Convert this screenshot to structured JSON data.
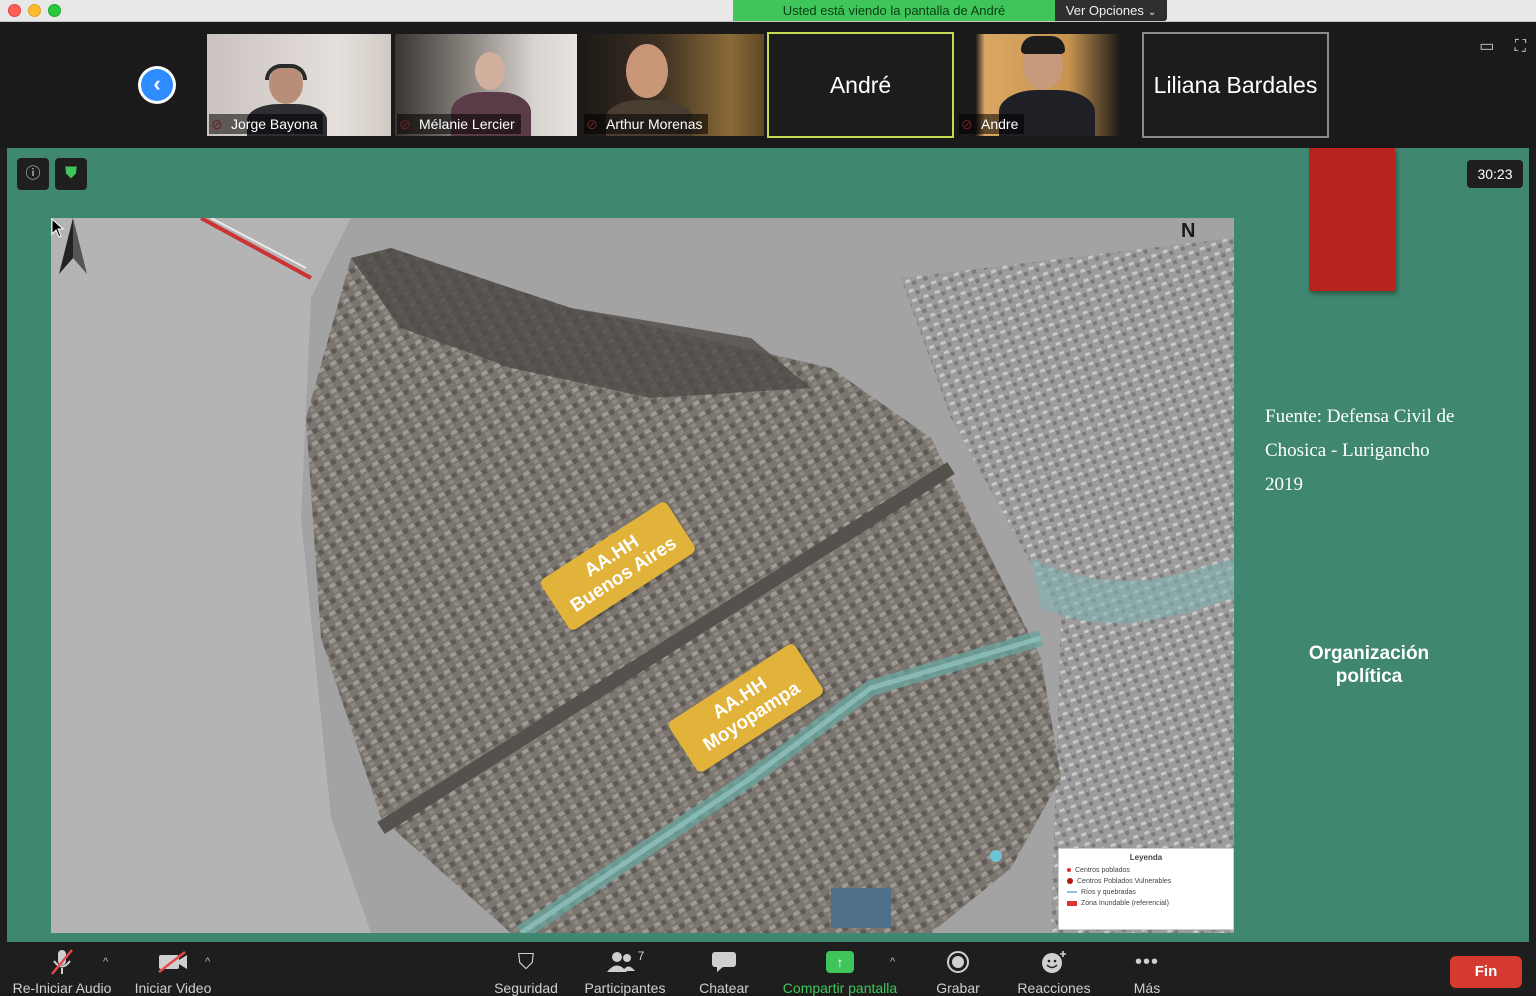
{
  "banner": {
    "sharing_text": "Usted está viendo la pantalla de André",
    "options_label": "Ver Opciones"
  },
  "participants": [
    {
      "name": "Jorge Bayona",
      "video": true,
      "muted": true
    },
    {
      "name": "Mélanie Lercier",
      "video": true,
      "muted": true
    },
    {
      "name": "Arthur Morenas",
      "video": true,
      "muted": true
    },
    {
      "name": "André",
      "video": false,
      "active_speaker": true
    },
    {
      "name": "Andre",
      "video": true,
      "muted": true
    },
    {
      "name": "Liliana Bardales",
      "video": false
    }
  ],
  "screen": {
    "timer": "30:23",
    "source_line1": "Fuente: Defensa Civil de",
    "source_line2": "Chosica - Lurigancho",
    "source_line3": "2019",
    "org_title": "Organización política",
    "map": {
      "north_label": "N",
      "tag1_line1": "AA.HH",
      "tag1_line2": "Buenos Aires",
      "tag2_line1": "AA.HH",
      "tag2_line2": "Moyopampa",
      "legend_title": "Leyenda",
      "legend_items": [
        "Centros poblados",
        "Centros Poblados Vulnerables",
        "Ríos y quebradas",
        "Zona Inundable (referencial)"
      ]
    }
  },
  "toolbar": {
    "audio": "Re-Iniciar Audio",
    "video": "Iniciar Video",
    "security": "Seguridad",
    "participants": "Participantes",
    "participants_count": "7",
    "chat": "Chatear",
    "share": "Compartir pantalla",
    "record": "Grabar",
    "reactions": "Reacciones",
    "more": "Más",
    "end": "Fin"
  },
  "colors": {
    "slide_bg": "#3f8770",
    "accent_red": "#b8231e",
    "tag_yellow": "#e2b33a",
    "share_green": "#3fc65a",
    "zoom_blue": "#2d8cff"
  }
}
